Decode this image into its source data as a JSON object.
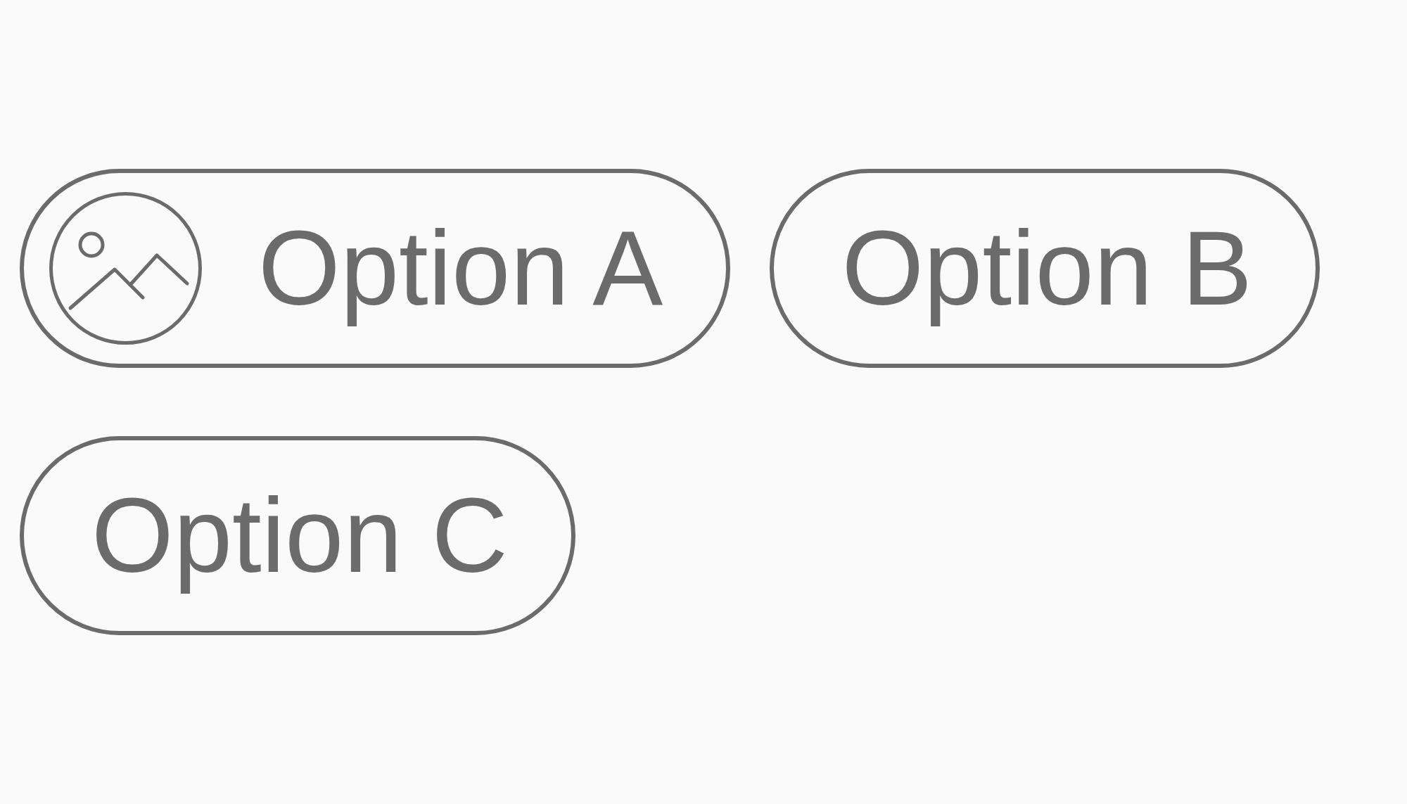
{
  "options": [
    {
      "label": "Option A",
      "kind": "image"
    },
    {
      "label": "Option B",
      "kind": "text"
    },
    {
      "label": "Option C",
      "kind": "text"
    }
  ]
}
